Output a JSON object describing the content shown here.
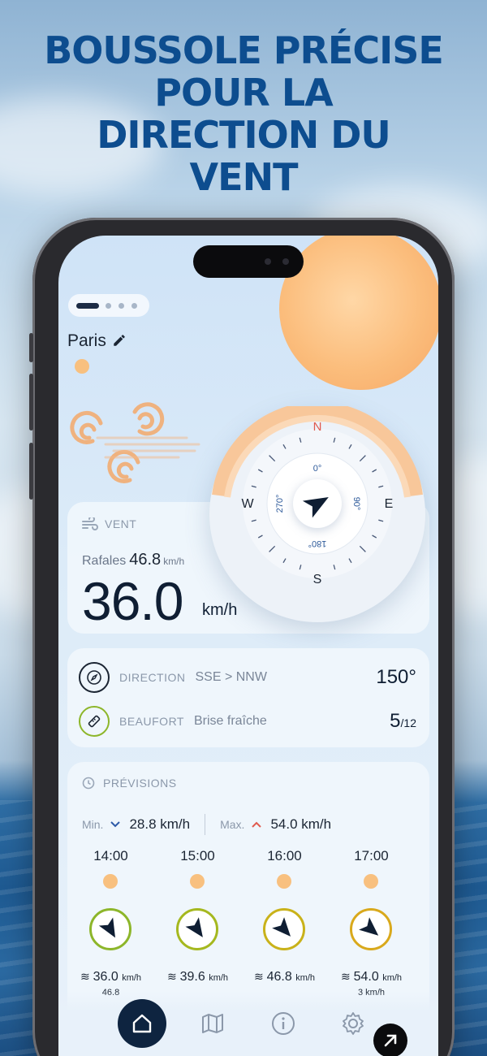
{
  "headline": [
    "BOUSSOLE PRÉCISE",
    "POUR LA",
    "DIRECTION DU",
    "VENT"
  ],
  "location": {
    "city": "Paris"
  },
  "compass": {
    "cardinals": {
      "n": "N",
      "e": "E",
      "s": "S",
      "w": "W"
    },
    "degrees": {
      "d0": "0°",
      "d90": "90°",
      "d180": "180°",
      "d270": "270°"
    },
    "heading_deg": 150
  },
  "wind": {
    "section_label": "VENT",
    "gust_label": "Rafales",
    "gust_value": "46.8",
    "gust_unit": "km/h",
    "speed_value": "36.0",
    "speed_unit": "km/h"
  },
  "details": {
    "direction_label": "DIRECTION",
    "direction_value": "SSE > NNW",
    "direction_deg": "150°",
    "beaufort_label": "BEAUFORT",
    "beaufort_value": "Brise fraîche",
    "beaufort_num": "5",
    "beaufort_max": "/12"
  },
  "forecast": {
    "section_label": "PRÉVISIONS",
    "min_label": "Min.",
    "min_value": "28.8 km/h",
    "max_label": "Max.",
    "max_value": "54.0 km/h",
    "hours": [
      {
        "time": "14:00",
        "speed": "36.0",
        "unit": "km/h",
        "gust": "46.8",
        "ring_color": "#8db62a",
        "rotation": 150
      },
      {
        "time": "15:00",
        "speed": "39.6",
        "unit": "km/h",
        "gust": "",
        "ring_color": "#a5b81f",
        "rotation": 145
      },
      {
        "time": "16:00",
        "speed": "46.8",
        "unit": "km/h",
        "gust": "",
        "ring_color": "#c9b21a",
        "rotation": 138
      },
      {
        "time": "17:00",
        "speed": "54.0",
        "unit": "km/h",
        "gust": "3 km/h",
        "ring_color": "#d9a91c",
        "rotation": 130
      }
    ]
  },
  "nav": {
    "items": [
      "home-icon",
      "map-icon",
      "info-icon",
      "settings-icon"
    ],
    "active": "home-icon"
  },
  "colors": {
    "accent_dark": "#0e2440",
    "headline": "#0d4d8f",
    "compass_arc": "#f6a865"
  }
}
